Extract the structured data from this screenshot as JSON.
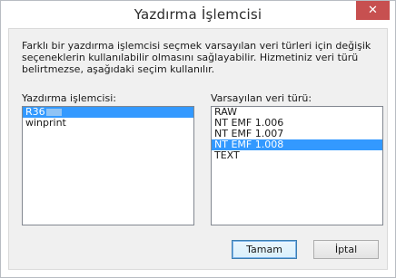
{
  "dialog": {
    "title": "Yazdırma İşlemcisi",
    "close_glyph": "✕",
    "description": "Farklı bir yazdırma işlemcisi seçmek varsayılan veri türleri için değişik seçeneklerin kullanılabilir olmasını sağlayabilir. Hizmetiniz veri türü belirtmezse, aşağıdaki seçim kullanılır."
  },
  "print_processor": {
    "label": "Yazdırma işlemcisi:",
    "items": [
      {
        "text": "R36",
        "selected": true,
        "redacted": true
      },
      {
        "text": "winprint",
        "selected": false
      }
    ]
  },
  "data_type": {
    "label": "Varsayılan veri türü:",
    "items": [
      {
        "text": "RAW",
        "selected": false
      },
      {
        "text": "NT EMF 1.006",
        "selected": false
      },
      {
        "text": "NT EMF 1.007",
        "selected": false
      },
      {
        "text": "NT EMF 1.008",
        "selected": true
      },
      {
        "text": "TEXT",
        "selected": false
      }
    ]
  },
  "buttons": {
    "ok_label": "Tamam",
    "cancel_label": "İptal"
  },
  "colors": {
    "selection": "#3399ff",
    "close_button": "#c75050",
    "content_background": "#f0f0f0"
  }
}
